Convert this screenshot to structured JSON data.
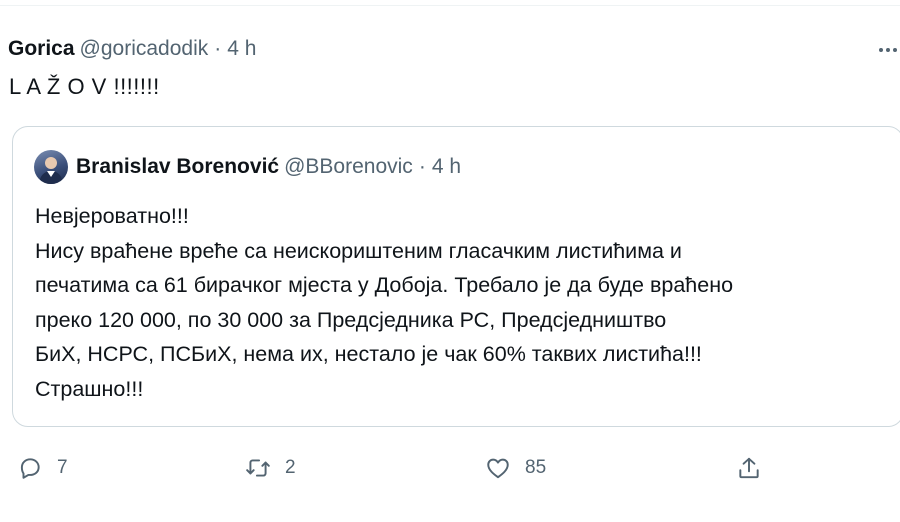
{
  "tweet": {
    "author_name": "Gorica",
    "author_handle": "@goricadodik",
    "separator": "·",
    "time": "4 h",
    "text": "L A Ž O V !!!!!!!",
    "more_icon": "more-horizontal-icon"
  },
  "quoted_tweet": {
    "author_name": "Branislav Borenović",
    "author_handle": "@BBorenovic",
    "separator": "·",
    "time": "4 h",
    "lines": [
      "Невјероватно!!!",
      "Нису враћене вреће са неискориштеним гласачким листићима и",
      "печатима са 61 бирачког мјеста у Добоја. Требало је да буде враћено",
      "преко 120 000, по 30 000 за Предсједника РС, Предсједништво",
      "БиХ, НСРС, ПСБиХ, нема их, нестало је чак 60% таквих листића!!!",
      "Страшно!!!"
    ]
  },
  "actions": {
    "reply": {
      "icon": "reply-icon",
      "count": "7"
    },
    "retweet": {
      "icon": "retweet-icon",
      "count": "2"
    },
    "like": {
      "icon": "like-icon",
      "count": "85"
    },
    "share": {
      "icon": "share-icon"
    }
  },
  "colors": {
    "text_primary": "#0f1419",
    "text_secondary": "#536471",
    "border": "#cfd9de"
  }
}
